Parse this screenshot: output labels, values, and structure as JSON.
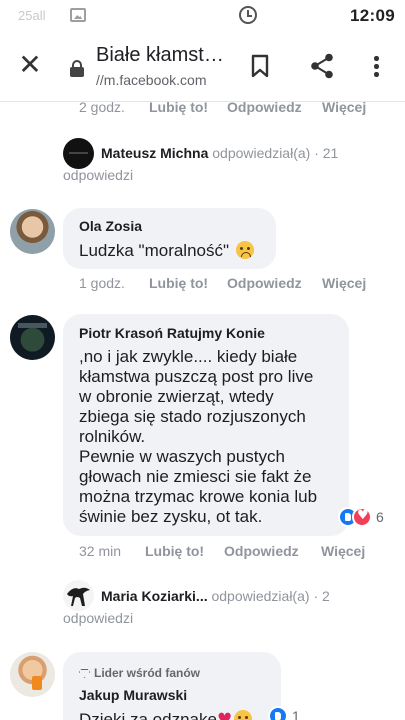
{
  "status_bar": {
    "carrier": "25all",
    "time": "12:09"
  },
  "toolbar": {
    "title": "Białe kłamst…",
    "url": "//m.facebook.com"
  },
  "labels": {
    "like": "Lubię to!",
    "reply": "Odpowiedz",
    "more": "Więcej"
  },
  "top_row": {
    "time": "2 godz."
  },
  "reply_thread_1": {
    "name": "Mateusz Michna",
    "action": "odpowiedział(a)",
    "sep": "·",
    "count_line1": "21",
    "count_line2": "odpowiedzi"
  },
  "comment_1": {
    "author": "Ola Zosia",
    "text": "Ludzka \"moralność\"",
    "time": "1 godz."
  },
  "comment_2": {
    "author": "Piotr Krasoń Ratujmy Konie",
    "text": ",no i jak zwykle.... kiedy białe\nkłamstwa puszczą post pro live\nw obronie zwierząt, wtedy\nzbiega się stado rozjuszonych\nrolników.\nPewnie w waszych pustych\ngłowach nie zmiesci sie fakt że\nmożna trzymac krowe konia lub\nświnie bez zysku, ot tak.",
    "time": "32 min",
    "reactions": "6"
  },
  "reply_thread_2": {
    "name": "Maria Koziarki...",
    "action": "odpowiedział(a)",
    "sep": "·",
    "count_line1": "2",
    "count_line2": "odpowiedzi"
  },
  "comment_3": {
    "badge": "Lider wśród fanów",
    "author": "Jakup Murawski",
    "text": "Dzieki za odznake",
    "reactions": "1"
  }
}
